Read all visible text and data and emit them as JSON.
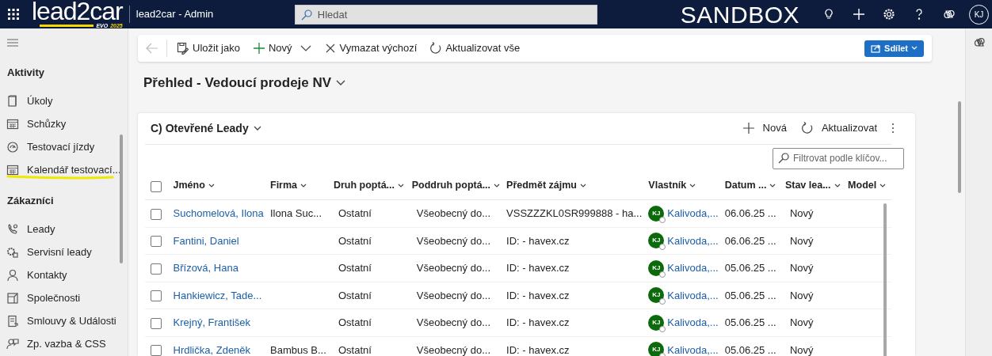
{
  "top_bar": {
    "logo": "lead2car",
    "logo_tagline_prefix": "EVO",
    "logo_tagline_year": "2025",
    "app_title": "lead2car - Admin",
    "search": {
      "placeholder": "Hledat"
    },
    "environment": "SANDBOX",
    "avatar": "KJ"
  },
  "sidebar": {
    "groups": [
      {
        "title": "Aktivity",
        "items": [
          {
            "label": "Úkoly"
          },
          {
            "label": "Schůzky"
          },
          {
            "label": "Testovací jízdy"
          },
          {
            "label": "Kalendář testovací..."
          }
        ]
      },
      {
        "title": "Zákazníci",
        "items": [
          {
            "label": "Leady"
          },
          {
            "label": "Servisní leady"
          },
          {
            "label": "Kontakty"
          },
          {
            "label": "Společnosti"
          },
          {
            "label": "Smlouvy & Události"
          },
          {
            "label": "Zp. vazba & CSS"
          }
        ]
      }
    ]
  },
  "toolbar": {
    "buttons": [
      {
        "kind": "save",
        "label": "Uložit jako"
      },
      {
        "kind": "new",
        "label": "Nový"
      },
      {
        "kind": "clear",
        "label": "Vymazat výchozí"
      },
      {
        "kind": "refresh",
        "label": "Aktualizovat vše"
      }
    ],
    "share": "Sdílet"
  },
  "view_title": "Přehled - Vedoucí prodeje NV",
  "grid": {
    "title": "C) Otevřené Leady",
    "actions": [
      {
        "kind": "add",
        "label": "Nová"
      },
      {
        "kind": "refresh",
        "label": "Aktualizovat"
      }
    ],
    "filter": {
      "placeholder": "Filtrovat podle klíčov..."
    },
    "select_all_checked": false,
    "columns": [
      "Jméno",
      "Firma",
      "Druh poptá...",
      "Poddruh poptá...",
      "Předmět zájmu",
      "Vlastník",
      "Datum ...",
      "Stav lea...",
      "Model"
    ],
    "rows": [
      {
        "checked": false,
        "name": "Suchomelová, Ilona",
        "company": "Ilona Suc...",
        "type": "Ostatní",
        "subtype": "Všeobecný do...",
        "subject": "VSSZZZKL0SR999888 - ha...",
        "owner": {
          "initials": "KJ",
          "name": "Kalivoda,..."
        },
        "date": "06.06.25 ...",
        "status": "Nový"
      },
      {
        "checked": false,
        "name": "Fantini, Daniel",
        "type": "Ostatní",
        "subtype": "Všeobecný do...",
        "subject": "ID:  - havex.cz",
        "owner": {
          "initials": "KJ",
          "name": "Kalivoda,..."
        },
        "date": "06.06.25 ...",
        "status": "Nový"
      },
      {
        "checked": false,
        "name": "Břízová, Hana",
        "type": "Ostatní",
        "subtype": "Všeobecný do...",
        "subject": "ID:  - havex.cz",
        "owner": {
          "initials": "KJ",
          "name": "Kalivoda,..."
        },
        "date": "05.06.25 ...",
        "status": "Nový"
      },
      {
        "checked": false,
        "name": "Hankiewicz, Tade...",
        "type": "Ostatní",
        "subtype": "Všeobecný do...",
        "subject": "ID:  - havex.cz",
        "owner": {
          "initials": "KJ",
          "name": "Kalivoda,..."
        },
        "date": "05.06.25 ...",
        "status": "Nový"
      },
      {
        "checked": false,
        "name": "Krejný, František",
        "type": "Ostatní",
        "subtype": "Všeobecný do...",
        "subject": "ID:  - havex.cz",
        "owner": {
          "initials": "KJ",
          "name": "Kalivoda,..."
        },
        "date": "05.06.25 ...",
        "status": "Nový"
      },
      {
        "checked": false,
        "name": "Hrdlička, Zdeněk",
        "company": "Bambus B...",
        "type": "Ostatní",
        "subtype": "Všeobecný do...",
        "subject": "ID:  - havex.cz",
        "owner": {
          "initials": "KJ",
          "name": "Kalivoda,..."
        },
        "date": "05.06.25 ...",
        "status": "Nový"
      }
    ]
  }
}
